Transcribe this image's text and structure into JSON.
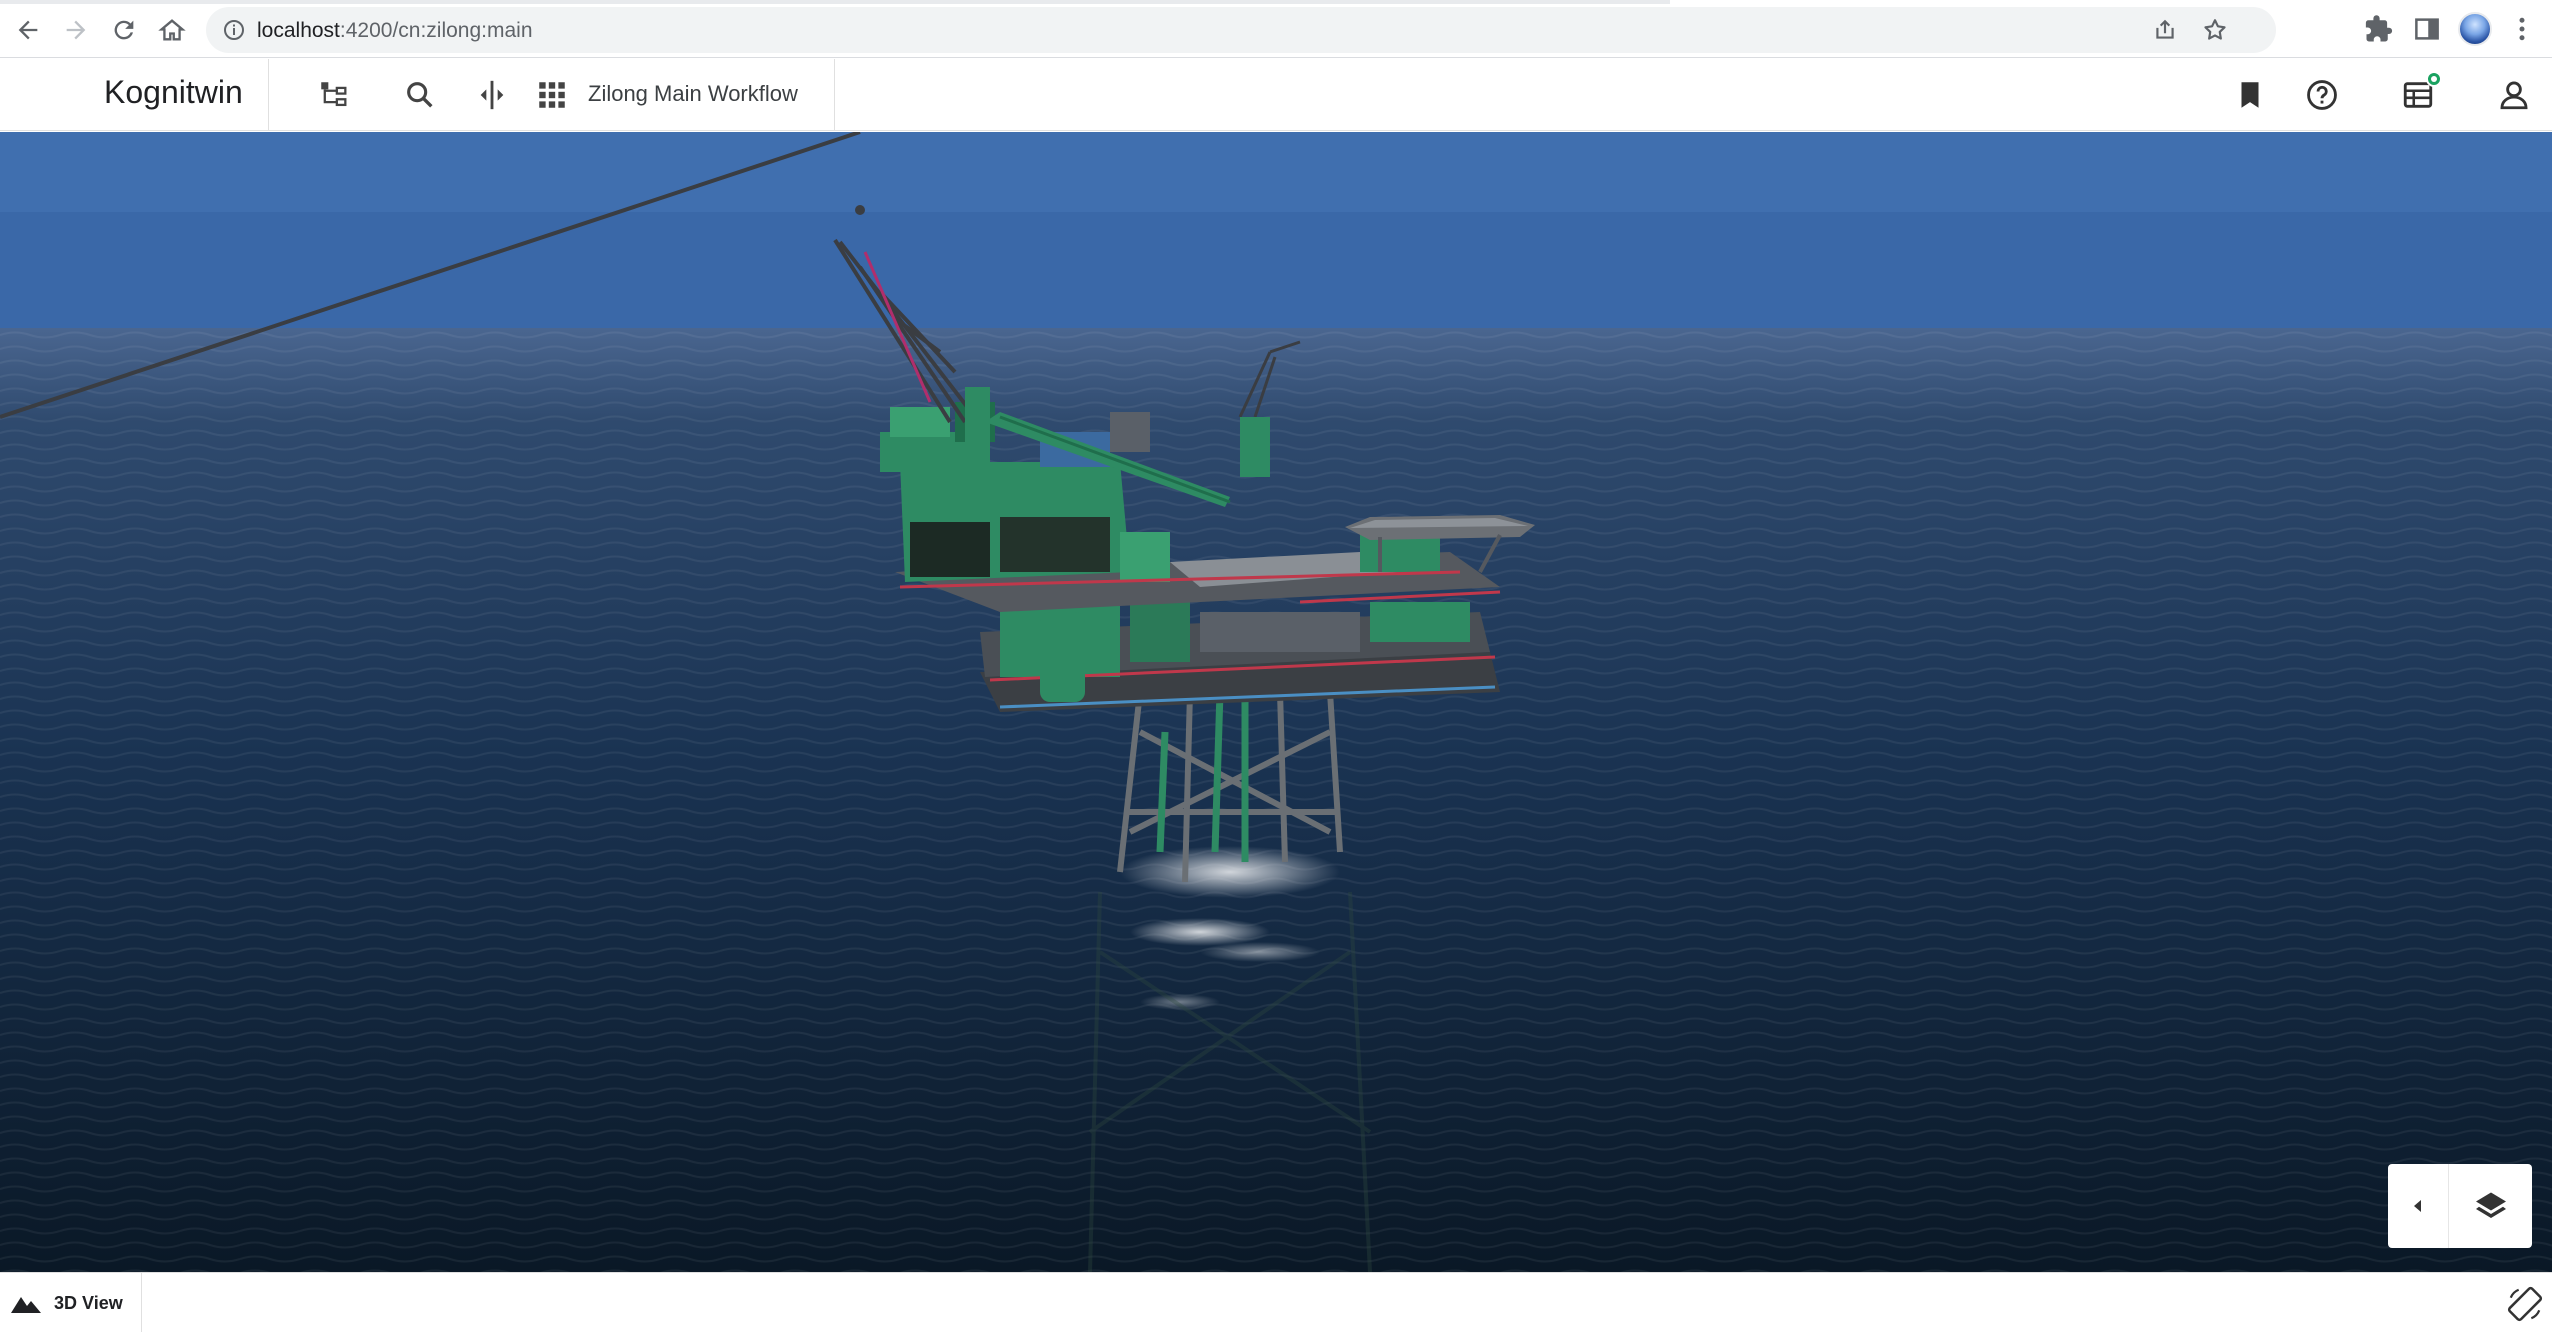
{
  "browser": {
    "url_host": "localhost",
    "url_path": ":4200/cn:zilong:main",
    "icons": [
      "back-icon",
      "forward-icon",
      "reload-icon",
      "home-icon",
      "site-info-icon",
      "share-icon",
      "bookmark-star-icon",
      "extensions-icon",
      "side-panel-icon",
      "profile-avatar",
      "menu-kebab-icon"
    ]
  },
  "header": {
    "brand": "Kognitwin",
    "workflow_title": "Zilong Main Workflow",
    "left_icons": [
      "hierarchy-icon",
      "search-icon",
      "split-view-icon",
      "apps-grid-icon"
    ],
    "right_icons": [
      "bookmark-icon",
      "help-icon",
      "tasks-icon",
      "user-icon"
    ],
    "notification_color": "#1aa260"
  },
  "viewport": {
    "scene": "3D view of offshore oil platform at sea",
    "controls": [
      "collapse-panel-icon",
      "layers-icon"
    ]
  },
  "footer": {
    "view_label": "3D View",
    "icons": [
      "terrain-icon",
      "rotate-screen-icon"
    ]
  },
  "colors": {
    "sky_top": "#3f6eb0",
    "sea_dark": "#0d1e30",
    "platform_green": "#2e8b63"
  }
}
